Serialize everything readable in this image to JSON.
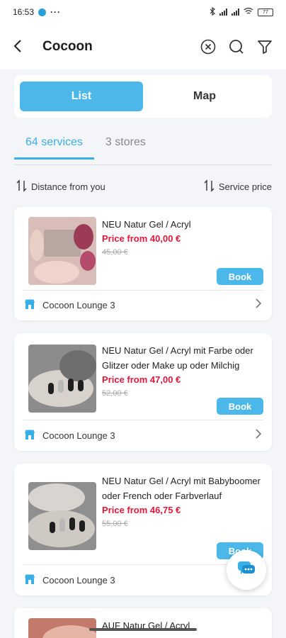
{
  "status": {
    "time": "16:53",
    "dots": "···",
    "battery": "77"
  },
  "header": {
    "title": "Cocoon"
  },
  "view_toggle": {
    "list": "List",
    "map": "Map"
  },
  "tabs": {
    "services": "64 services",
    "stores": "3 stores"
  },
  "sort": {
    "distance": "Distance from you",
    "price": "Service price"
  },
  "cards": [
    {
      "name": "NEU Natur Gel / Acryl",
      "price": "Price from 40,00 €",
      "old": "45,00 €",
      "book": "Book",
      "store": "Cocoon Lounge 3"
    },
    {
      "name": "NEU Natur Gel / Acryl mit Farbe oder Glitzer oder Make up oder Milchig",
      "price": "Price from 47,00 €",
      "old": "52,00 €",
      "book": "Book",
      "store": "Cocoon Lounge 3"
    },
    {
      "name": "NEU Natur Gel / Acryl mit Babyboomer oder French oder Farbverlauf",
      "price": "Price from 46,75 €",
      "old": "55,00 €",
      "book": "Book",
      "store": "Cocoon Lounge 3"
    },
    {
      "name": "AUF Natur Gel / Acryl"
    }
  ],
  "colors": {
    "accent": "#4cb8ea",
    "price": "#e0183a"
  }
}
